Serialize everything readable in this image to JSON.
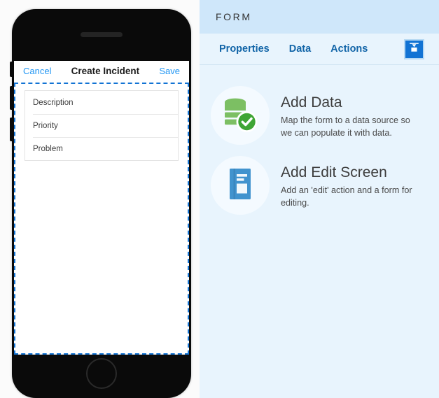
{
  "phone": {
    "nav": {
      "cancel_label": "Cancel",
      "title": "Create Incident",
      "save_label": "Save"
    },
    "fields": [
      {
        "label": "Description"
      },
      {
        "label": "Priority"
      },
      {
        "label": "Problem"
      }
    ]
  },
  "panel": {
    "header_title": "FORM",
    "tabs": [
      {
        "label": "Properties"
      },
      {
        "label": "Data"
      },
      {
        "label": "Actions"
      }
    ],
    "wizard_button": {
      "icon": "form-wizard-icon"
    },
    "cards": [
      {
        "icon": "database-check-icon",
        "title": "Add Data",
        "description": "Map the form to a data source so we can populate it with data."
      },
      {
        "icon": "edit-screen-icon",
        "title": "Add Edit Screen",
        "description": "Add an 'edit' action and a form for editing."
      }
    ]
  },
  "colors": {
    "accent_blue": "#1273d4",
    "link_blue": "#2196f3",
    "tab_blue": "#1265a8",
    "panel_bg": "#e8f4fd",
    "panel_header_bg": "#cfe7fa",
    "green": "#7cbf63",
    "green_check": "#3fa535",
    "icon_blue": "#4193ce"
  }
}
